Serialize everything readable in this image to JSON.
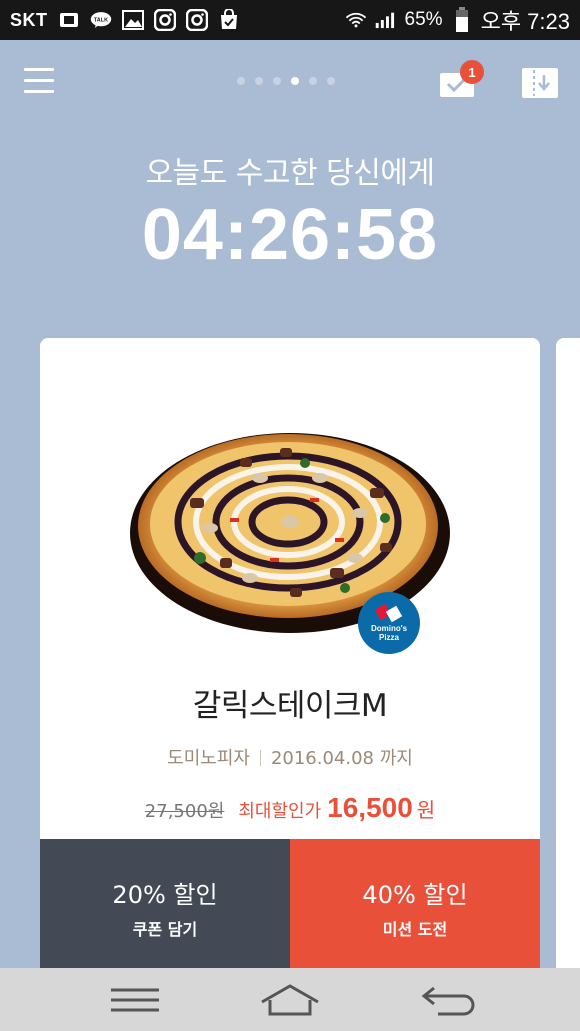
{
  "status_bar": {
    "carrier": "SKT",
    "kakao_label": "TALK",
    "battery": "65%",
    "time": "오후 7:23"
  },
  "header": {
    "page_count": 6,
    "active_page": 4,
    "notification_count": "1"
  },
  "hero": {
    "greeting": "오늘도 수고한 당신에게",
    "timer": "04:26:58"
  },
  "card": {
    "brand_logo_text": "Domino's Pizza",
    "product_name": "갈릭스테이크M",
    "brand": "도미노피자",
    "expiry": "2016.04.08 까지",
    "original_price": "27,500원",
    "max_discount_label": "최대할인가",
    "sale_price": "16,500",
    "currency": "원",
    "left_action": {
      "title": "20% 할인",
      "subtitle": "쿠폰 담기"
    },
    "right_action": {
      "title": "40% 할인",
      "subtitle": "미션 도전"
    }
  },
  "colors": {
    "background": "#aabcd4",
    "accent": "#e8503a",
    "dark_button": "#434955",
    "domino_blue": "#0b6aa8"
  }
}
